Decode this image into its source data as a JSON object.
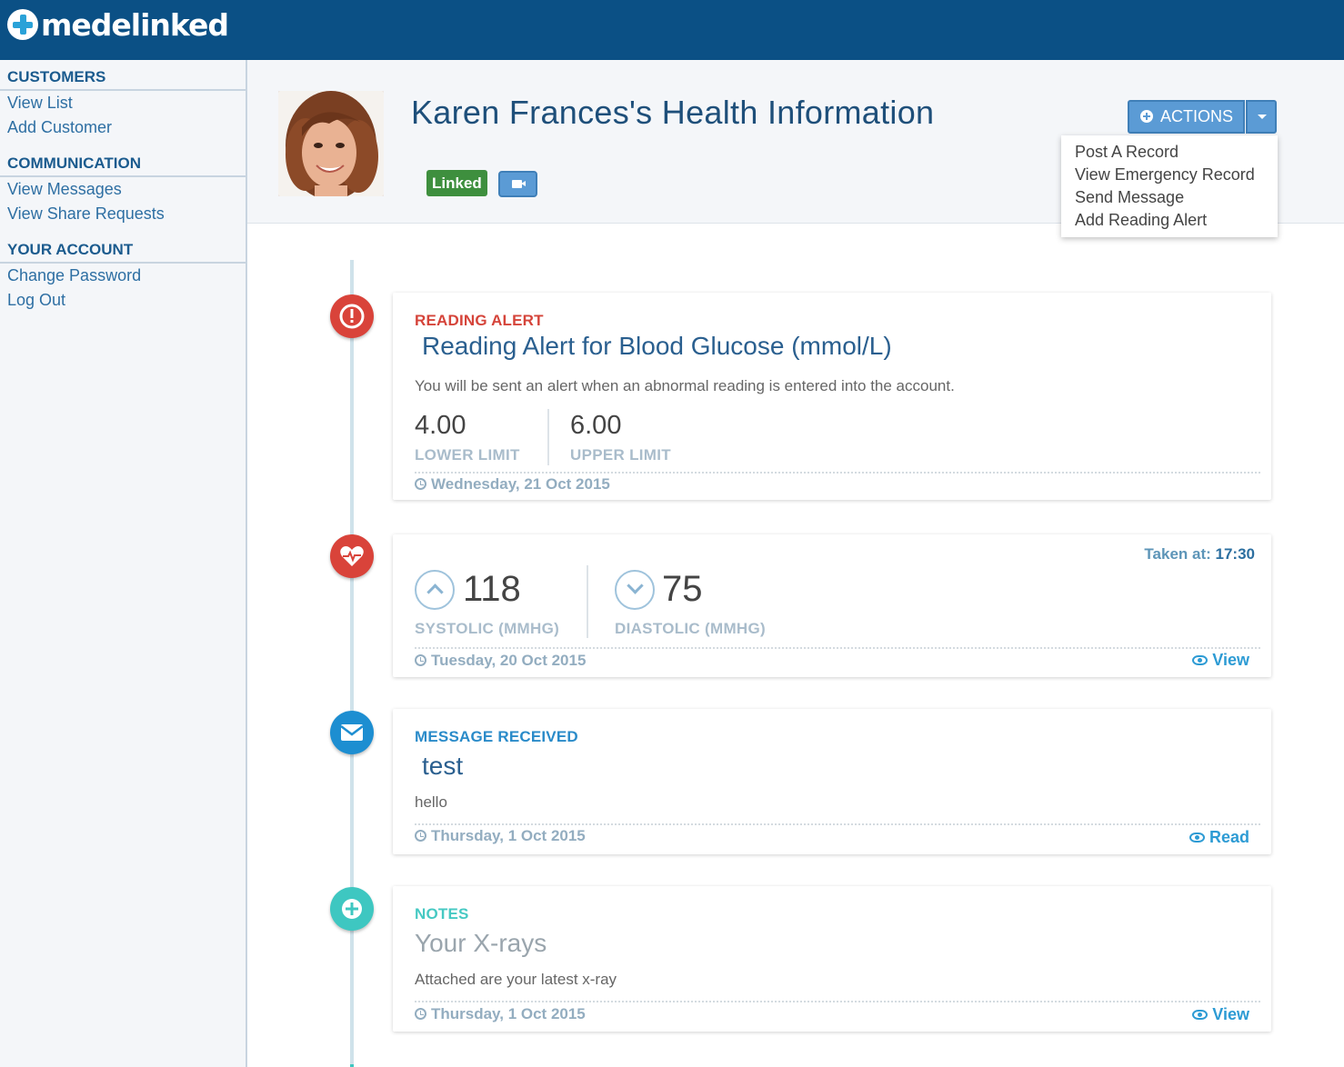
{
  "brand": {
    "logo_text": "medelinked"
  },
  "sidebar": {
    "sections": [
      {
        "heading": "CUSTOMERS",
        "links": [
          "View List",
          "Add Customer"
        ]
      },
      {
        "heading": "COMMUNICATION",
        "links": [
          "View Messages",
          "View Share Requests"
        ]
      },
      {
        "heading": "YOUR ACCOUNT",
        "links": [
          "Change Password",
          "Log Out"
        ]
      }
    ]
  },
  "header": {
    "title": "Karen Frances's Health Information",
    "badge": "Linked",
    "actions_label": "ACTIONS",
    "menu": [
      "Post A Record",
      "View Emergency Record",
      "Send Message",
      "Add Reading Alert"
    ]
  },
  "timeline": {
    "alert": {
      "category": "READING ALERT",
      "title": "Reading Alert for Blood Glucose (mmol/L)",
      "description": "You will be sent an alert when an abnormal reading is entered into the account.",
      "lower_value": "4.00",
      "lower_label": "LOWER LIMIT",
      "upper_value": "6.00",
      "upper_label": "UPPER LIMIT",
      "date": "Wednesday, 21 Oct 2015"
    },
    "bp": {
      "taken_label": "Taken at:",
      "taken_time": "17:30",
      "systolic_value": "118",
      "systolic_label": "SYSTOLIC (MMHG)",
      "diastolic_value": "75",
      "diastolic_label": "DIASTOLIC (MMHG)",
      "date": "Tuesday, 20 Oct 2015",
      "link": "View"
    },
    "message": {
      "category": "MESSAGE RECEIVED",
      "title": "test",
      "body": "hello",
      "date": "Thursday, 1 Oct 2015",
      "link": "Read"
    },
    "notes": {
      "category": "NOTES",
      "title": "Your X-rays",
      "body": "Attached are your latest x-ray",
      "date": "Thursday, 1 Oct 2015",
      "link": "View"
    }
  },
  "colors": {
    "topbar": "#0b5085",
    "accent_blue": "#2d9bd4",
    "alert_red": "#d9433a",
    "notes_teal": "#3ec7c1",
    "linked_green": "#3e8f3e"
  }
}
